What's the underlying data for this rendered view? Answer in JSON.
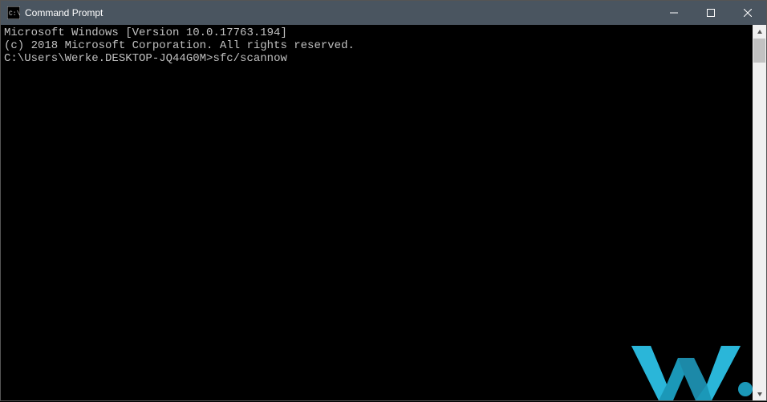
{
  "titlebar": {
    "title": "Command Prompt"
  },
  "terminal": {
    "line1": "Microsoft Windows [Version 10.0.17763.194]",
    "line2": "(c) 2018 Microsoft Corporation. All rights reserved.",
    "blank": "",
    "prompt": "C:\\Users\\Werke.DESKTOP-JQ44G0M>",
    "command": "sfc/scannow"
  }
}
